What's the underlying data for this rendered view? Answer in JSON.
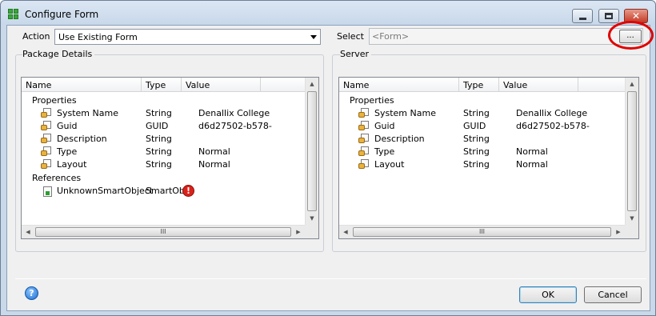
{
  "window": {
    "title": "Configure Form"
  },
  "top": {
    "action_label": "Action",
    "action_value": "Use Existing Form",
    "select_label": "Select",
    "select_value": "<Form>",
    "browse_label": "..."
  },
  "package": {
    "label": "Package Details",
    "columns": [
      "Name",
      "Type",
      "Value"
    ],
    "properties_label": "Properties",
    "properties": [
      {
        "name": "System Name",
        "type": "String",
        "value": "Denallix College"
      },
      {
        "name": "Guid",
        "type": "GUID",
        "value": "d6d27502-b578-"
      },
      {
        "name": "Description",
        "type": "String",
        "value": ""
      },
      {
        "name": "Type",
        "type": "String",
        "value": "Normal"
      },
      {
        "name": "Layout",
        "type": "String",
        "value": "Normal"
      }
    ],
    "references_label": "References",
    "references": [
      {
        "name": "UnknownSmartObject",
        "type": "SmartObj",
        "status": "error"
      }
    ]
  },
  "server": {
    "label": "Server",
    "columns": [
      "Name",
      "Type",
      "Value"
    ],
    "properties_label": "Properties",
    "properties": [
      {
        "name": "System Name",
        "type": "String",
        "value": "Denallix College"
      },
      {
        "name": "Guid",
        "type": "GUID",
        "value": "d6d27502-b578-"
      },
      {
        "name": "Description",
        "type": "String",
        "value": ""
      },
      {
        "name": "Type",
        "type": "String",
        "value": "Normal"
      },
      {
        "name": "Layout",
        "type": "String",
        "value": "Normal"
      }
    ]
  },
  "scrollbar": {
    "grip": "III"
  },
  "footer": {
    "help_glyph": "?",
    "ok_label": "OK",
    "cancel_label": "Cancel"
  },
  "colors": {
    "highlight": "#e00000",
    "error": "#d8231b"
  }
}
